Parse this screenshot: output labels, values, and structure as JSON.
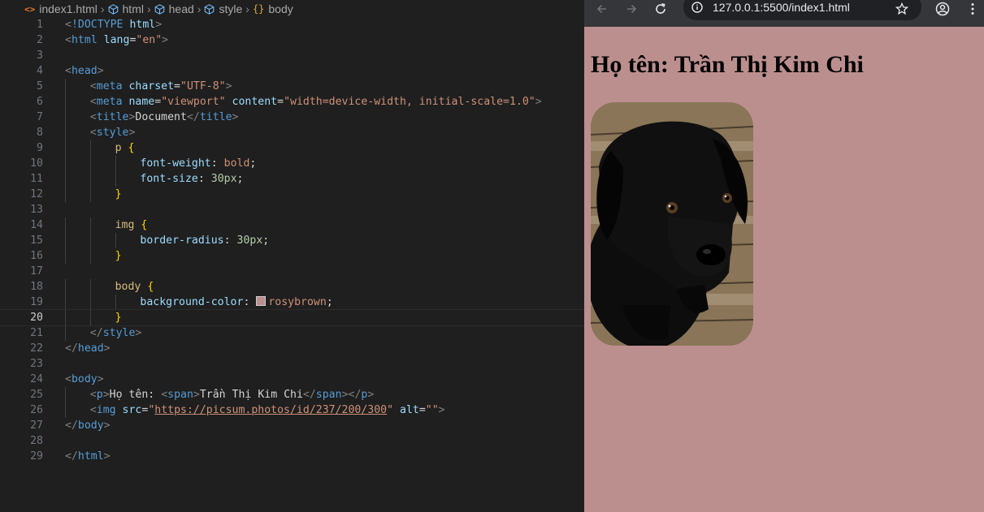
{
  "editor": {
    "breadcrumb": [
      {
        "icon": "html-file-icon",
        "label": "index1.html"
      },
      {
        "icon": "cube-icon",
        "label": "html"
      },
      {
        "icon": "cube-icon",
        "label": "head"
      },
      {
        "icon": "cube-icon",
        "label": "style"
      },
      {
        "icon": "braces-icon",
        "label": "body"
      }
    ],
    "current_line": 20,
    "lines": [
      {
        "n": "1",
        "indent": 0,
        "tokens": [
          [
            "t-bracket",
            "<"
          ],
          [
            "t-tag",
            "!DOCTYPE"
          ],
          [
            "t-plain",
            " "
          ],
          [
            "t-attr",
            "html"
          ],
          [
            "t-bracket",
            ">"
          ]
        ]
      },
      {
        "n": "2",
        "indent": 0,
        "tokens": [
          [
            "t-bracket",
            "<"
          ],
          [
            "t-tag",
            "html"
          ],
          [
            "t-plain",
            " "
          ],
          [
            "t-attr",
            "lang"
          ],
          [
            "t-plain",
            "="
          ],
          [
            "t-str",
            "\"en\""
          ],
          [
            "t-bracket",
            ">"
          ]
        ]
      },
      {
        "n": "3",
        "indent": 0,
        "tokens": []
      },
      {
        "n": "4",
        "indent": 0,
        "tokens": [
          [
            "t-bracket",
            "<"
          ],
          [
            "t-tag",
            "head"
          ],
          [
            "t-bracket",
            ">"
          ]
        ]
      },
      {
        "n": "5",
        "indent": 1,
        "tokens": [
          [
            "t-bracket",
            "<"
          ],
          [
            "t-tag",
            "meta"
          ],
          [
            "t-plain",
            " "
          ],
          [
            "t-attr",
            "charset"
          ],
          [
            "t-plain",
            "="
          ],
          [
            "t-str",
            "\"UTF-8\""
          ],
          [
            "t-bracket",
            ">"
          ]
        ]
      },
      {
        "n": "6",
        "indent": 1,
        "tokens": [
          [
            "t-bracket",
            "<"
          ],
          [
            "t-tag",
            "meta"
          ],
          [
            "t-plain",
            " "
          ],
          [
            "t-attr",
            "name"
          ],
          [
            "t-plain",
            "="
          ],
          [
            "t-str",
            "\"viewport\""
          ],
          [
            "t-plain",
            " "
          ],
          [
            "t-attr",
            "content"
          ],
          [
            "t-plain",
            "="
          ],
          [
            "t-str",
            "\"width=device-width, initial-scale=1.0\""
          ],
          [
            "t-bracket",
            ">"
          ]
        ]
      },
      {
        "n": "7",
        "indent": 1,
        "tokens": [
          [
            "t-bracket",
            "<"
          ],
          [
            "t-tag",
            "title"
          ],
          [
            "t-bracket",
            ">"
          ],
          [
            "t-plain",
            "Document"
          ],
          [
            "t-bracket",
            "</"
          ],
          [
            "t-tag",
            "title"
          ],
          [
            "t-bracket",
            ">"
          ]
        ]
      },
      {
        "n": "8",
        "indent": 1,
        "tokens": [
          [
            "t-bracket",
            "<"
          ],
          [
            "t-tag",
            "style"
          ],
          [
            "t-bracket",
            ">"
          ]
        ]
      },
      {
        "n": "9",
        "indent": 2,
        "tokens": [
          [
            "t-sel",
            "p"
          ],
          [
            "t-plain",
            " "
          ],
          [
            "t-brace",
            "{"
          ]
        ]
      },
      {
        "n": "10",
        "indent": 3,
        "tokens": [
          [
            "t-prop",
            "font-weight"
          ],
          [
            "t-plain",
            ": "
          ],
          [
            "t-val",
            "bold"
          ],
          [
            "t-plain",
            ";"
          ]
        ]
      },
      {
        "n": "11",
        "indent": 3,
        "tokens": [
          [
            "t-prop",
            "font-size"
          ],
          [
            "t-plain",
            ": "
          ],
          [
            "t-num",
            "30px"
          ],
          [
            "t-plain",
            ";"
          ]
        ]
      },
      {
        "n": "12",
        "indent": 2,
        "tokens": [
          [
            "t-brace",
            "}"
          ]
        ]
      },
      {
        "n": "13",
        "indent": 0,
        "tokens": []
      },
      {
        "n": "14",
        "indent": 2,
        "tokens": [
          [
            "t-sel",
            "img"
          ],
          [
            "t-plain",
            " "
          ],
          [
            "t-brace",
            "{"
          ]
        ]
      },
      {
        "n": "15",
        "indent": 3,
        "tokens": [
          [
            "t-prop",
            "border-radius"
          ],
          [
            "t-plain",
            ": "
          ],
          [
            "t-num",
            "30px"
          ],
          [
            "t-plain",
            ";"
          ]
        ]
      },
      {
        "n": "16",
        "indent": 2,
        "tokens": [
          [
            "t-brace",
            "}"
          ]
        ]
      },
      {
        "n": "17",
        "indent": 0,
        "tokens": []
      },
      {
        "n": "18",
        "indent": 2,
        "tokens": [
          [
            "t-sel",
            "body"
          ],
          [
            "t-plain",
            " "
          ],
          [
            "t-brace",
            "{"
          ]
        ]
      },
      {
        "n": "19",
        "indent": 3,
        "tokens": [
          [
            "t-prop",
            "background-color"
          ],
          [
            "t-plain",
            ": "
          ],
          [
            "swatch",
            ""
          ],
          [
            "t-val",
            "rosybrown"
          ],
          [
            "t-plain",
            ";"
          ]
        ]
      },
      {
        "n": "20",
        "indent": 2,
        "tokens": [
          [
            "t-brace",
            "}"
          ]
        ]
      },
      {
        "n": "21",
        "indent": 1,
        "tokens": [
          [
            "t-bracket",
            "</"
          ],
          [
            "t-tag",
            "style"
          ],
          [
            "t-bracket",
            ">"
          ]
        ]
      },
      {
        "n": "22",
        "indent": 0,
        "tokens": [
          [
            "t-bracket",
            "</"
          ],
          [
            "t-tag",
            "head"
          ],
          [
            "t-bracket",
            ">"
          ]
        ]
      },
      {
        "n": "23",
        "indent": 0,
        "tokens": []
      },
      {
        "n": "24",
        "indent": 0,
        "tokens": [
          [
            "t-bracket",
            "<"
          ],
          [
            "t-tag",
            "body"
          ],
          [
            "t-bracket",
            ">"
          ]
        ]
      },
      {
        "n": "25",
        "indent": 1,
        "tokens": [
          [
            "t-bracket",
            "<"
          ],
          [
            "t-tag",
            "p"
          ],
          [
            "t-bracket",
            ">"
          ],
          [
            "t-plain",
            "Họ tên: "
          ],
          [
            "t-bracket",
            "<"
          ],
          [
            "t-tag",
            "span"
          ],
          [
            "t-bracket",
            ">"
          ],
          [
            "t-plain",
            "Trần Thị Kim Chi"
          ],
          [
            "t-bracket",
            "</"
          ],
          [
            "t-tag",
            "span"
          ],
          [
            "t-bracket",
            "></"
          ],
          [
            "t-tag",
            "p"
          ],
          [
            "t-bracket",
            ">"
          ]
        ]
      },
      {
        "n": "26",
        "indent": 1,
        "tokens": [
          [
            "t-bracket",
            "<"
          ],
          [
            "t-tag",
            "img"
          ],
          [
            "t-plain",
            " "
          ],
          [
            "t-attr",
            "src"
          ],
          [
            "t-plain",
            "="
          ],
          [
            "t-str",
            "\""
          ],
          [
            "t-link",
            "https://picsum.photos/id/237/200/300"
          ],
          [
            "t-str",
            "\""
          ],
          [
            "t-plain",
            " "
          ],
          [
            "t-attr",
            "alt"
          ],
          [
            "t-plain",
            "="
          ],
          [
            "t-str",
            "\"\""
          ],
          [
            "t-bracket",
            ">"
          ]
        ]
      },
      {
        "n": "27",
        "indent": 0,
        "tokens": [
          [
            "t-bracket",
            "</"
          ],
          [
            "t-tag",
            "body"
          ],
          [
            "t-bracket",
            ">"
          ]
        ]
      },
      {
        "n": "28",
        "indent": 0,
        "tokens": []
      },
      {
        "n": "29",
        "indent": 0,
        "tokens": [
          [
            "t-bracket",
            "</"
          ],
          [
            "t-tag",
            "html"
          ],
          [
            "t-bracket",
            ">"
          ]
        ]
      }
    ]
  },
  "browser": {
    "url": "127.0.0.1:5500/index1.html",
    "page": {
      "label": "Họ tên: ",
      "name": "Trần Thị Kim Chi"
    },
    "colors": {
      "page_background": "#bc8f8f"
    }
  }
}
